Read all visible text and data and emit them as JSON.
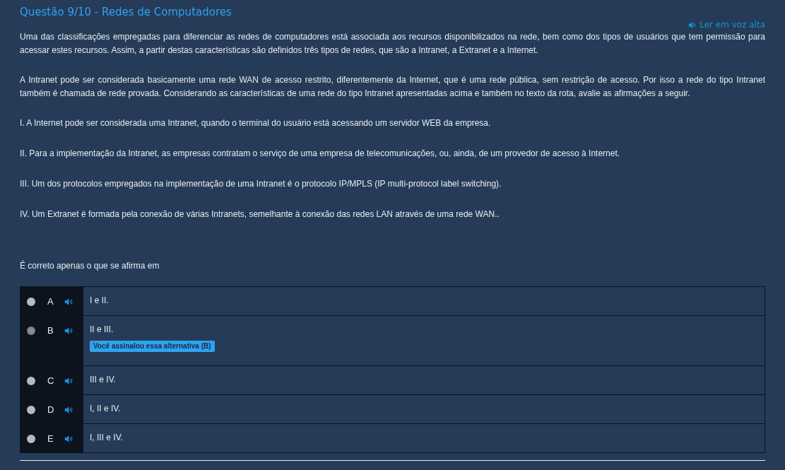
{
  "title": "Questão 9/10 - Redes de Computadores",
  "read_aloud": "Ler em voz alta",
  "paragraphs": [
    "Uma das classificações empregadas para diferenciar as redes de computadores está associada aos recursos disponibilizados na rede, bem como dos tipos de usuários que tem permissão para acessar estes recursos. Assim, a partir destas características são definidos três tipos de redes, que são a Intranet, a Extranet e a Internet.",
    "A Intranet pode ser considerada basicamente uma rede WAN de acesso restrito, diferentemente da Internet, que é uma rede pública, sem restrição de acesso. Por isso a rede do tipo Intranet também é chamada de rede provada. Considerando as características de uma rede do tipo Intranet apresentadas acima e também no texto da rota, avalie as afirmações a seguir."
  ],
  "statements": [
    "I. A Internet pode ser considerada uma Intranet, quando o terminal do usuário está acessando um servidor WEB da empresa.",
    "II. Para a implementação da Intranet, as empresas contratam o serviço de uma empresa de telecomunicações, ou, ainda, de um provedor de acesso à Internet.",
    "III. Um dos protocolos empregados na implementação de uma Intranet é o protocolo IP/MPLS (IP multi-protocol label switching).",
    "IV. Um Extranet é formada pela conexão de várias Intranets, semelhante à conexão das redes LAN através de uma rede WAN.."
  ],
  "prompt": "É correto apenas o que se afirma em",
  "options": [
    {
      "letter": "A",
      "text": "I e II.",
      "selected": false
    },
    {
      "letter": "B",
      "text": "II e III.",
      "selected": true,
      "badge": "Você assinalou essa alternativa (B)"
    },
    {
      "letter": "C",
      "text": "III e IV.",
      "selected": false
    },
    {
      "letter": "D",
      "text": "I, II e IV.",
      "selected": false
    },
    {
      "letter": "E",
      "text": "I, III e IV.",
      "selected": false
    }
  ]
}
